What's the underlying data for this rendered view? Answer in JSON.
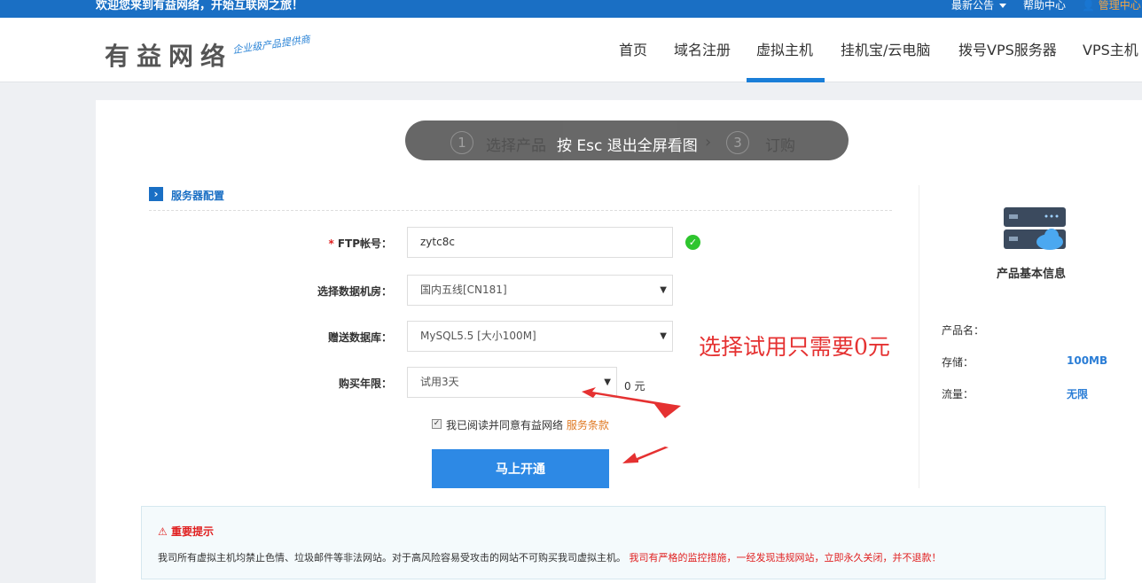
{
  "topbar": {
    "welcome": "欢迎您来到有益网络，开始互联网之旅！",
    "notice": "最新公告",
    "help": "帮助中心",
    "member": "管理中心"
  },
  "header": {
    "logo": "有益网络",
    "slogan": "企业级产品提供商",
    "nav": [
      "首页",
      "域名注册",
      "虚拟主机",
      "挂机宝/云电脑",
      "拨号VPS服务器",
      "VPS主机"
    ]
  },
  "steps": {
    "items": [
      {
        "num": "1",
        "label": "选择产品"
      },
      {
        "num": "3",
        "label": "订购"
      }
    ],
    "esc_tip": "按 Esc 退出全屏看图"
  },
  "section": {
    "title": "服务器配置"
  },
  "form": {
    "ftp_label": "FTP帐号：",
    "ftp_value": "zytc8c",
    "datacenter_label": "选择数据机房：",
    "datacenter_value": "国内五线[CN181]",
    "database_label": "赠送数据库：",
    "database_value": "MySQL5.5 [大小100M]",
    "period_label": "购买年限：",
    "period_value": "试用3天",
    "price": "0 元",
    "agree_text": "我已阅读并同意有益网络",
    "agree_link": "服务条款",
    "submit": "马上开通"
  },
  "annotation": "选择试用只需要0元",
  "info": {
    "title": "产品基本信息",
    "rows": [
      {
        "key": "产品名：",
        "value": ""
      },
      {
        "key": "存储：",
        "value": "100MB"
      },
      {
        "key": "流量：",
        "value": "无限"
      }
    ]
  },
  "warning": {
    "title": "重要提示",
    "text": "我司所有虚拟主机均禁止色情、垃圾邮件等非法网站。对于高风险容易受攻击的网站不可购买我司虚拟主机。",
    "red_text": "我司有严格的监控措施，一经发现违规网站，立即永久关闭，并不退款！"
  },
  "colors": {
    "brand_blue": "#1a6fc4",
    "button_blue": "#2d89e5",
    "alert_red": "#e02020"
  }
}
